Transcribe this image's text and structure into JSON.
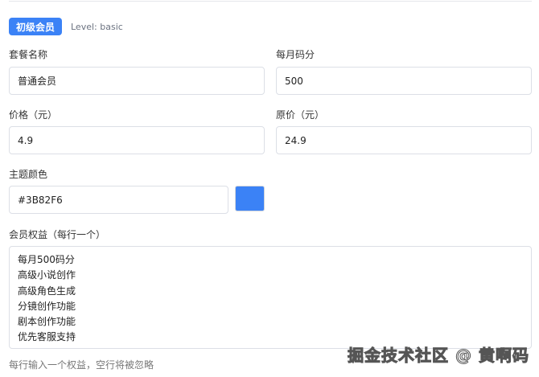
{
  "badge": {
    "label": "初级会员",
    "level_text": "Level: basic",
    "color": "#3B82F6"
  },
  "fields": {
    "name": {
      "label": "套餐名称",
      "value": "普通会员"
    },
    "monthly_points": {
      "label": "每月码分",
      "value": "500"
    },
    "price": {
      "label": "价格（元）",
      "value": "4.9"
    },
    "original_price": {
      "label": "原价（元）",
      "value": "24.9"
    },
    "theme_color": {
      "label": "主题颜色",
      "value": "#3B82F6"
    },
    "benefits": {
      "label": "会员权益（每行一个）",
      "lines": [
        "每月500码分",
        "高级小说创作",
        "高级角色生成",
        "分镜创作功能",
        "剧本创作功能",
        "优先客服支持"
      ],
      "hint": "每行输入一个权益，空行将被忽略"
    }
  },
  "watermark": "掘金技术社区 @ 黄啊码"
}
